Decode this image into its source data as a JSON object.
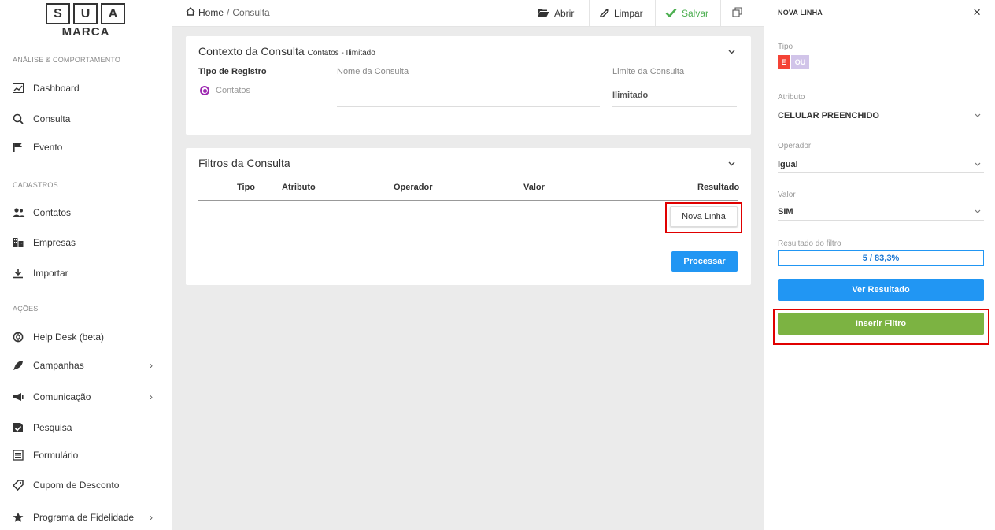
{
  "logo": {
    "letters": [
      "S",
      "U",
      "A"
    ],
    "text": "MARCA"
  },
  "sidebar": {
    "sections": [
      {
        "label": "ANÁLISE & COMPORTAMENTO"
      },
      {
        "label": "CADASTROS"
      },
      {
        "label": "AÇÕES"
      }
    ],
    "items": [
      {
        "label": "Dashboard",
        "icon": "chart-icon"
      },
      {
        "label": "Consulta",
        "icon": "search-icon"
      },
      {
        "label": "Evento",
        "icon": "flag-icon"
      },
      {
        "label": "Contatos",
        "icon": "contacts-icon"
      },
      {
        "label": "Empresas",
        "icon": "building-icon"
      },
      {
        "label": "Importar",
        "icon": "download-icon"
      },
      {
        "label": "Help Desk (beta)",
        "icon": "lifebuoy-icon"
      },
      {
        "label": "Campanhas",
        "icon": "rocket-icon",
        "chevron": "›"
      },
      {
        "label": "Comunicação",
        "icon": "megaphone-icon",
        "chevron": "›"
      },
      {
        "label": "Pesquisa",
        "icon": "survey-icon"
      },
      {
        "label": "Formulário",
        "icon": "form-icon"
      },
      {
        "label": "Cupom de Desconto",
        "icon": "tag-icon"
      },
      {
        "label": "Programa de Fidelidade",
        "icon": "star-icon",
        "chevron": "›"
      }
    ]
  },
  "topbar": {
    "breadcrumb": {
      "home": "Home",
      "separator": "/",
      "current": "Consulta"
    },
    "buttons": {
      "open": "Abrir",
      "clear": "Limpar",
      "save": "Salvar"
    }
  },
  "context_card": {
    "title": "Contexto da Consulta",
    "subtitle": "Contatos - Ilimitado",
    "record_type_label": "Tipo de Registro",
    "record_type_value": "Contatos",
    "name_label": "Nome da Consulta",
    "name_value": "",
    "limit_label": "Limite da Consulta",
    "limit_value": "Ilimitado"
  },
  "filters_card": {
    "title": "Filtros da Consulta",
    "columns": [
      "Tipo",
      "Atributo",
      "Operador",
      "Valor",
      "Resultado"
    ],
    "new_line_button": "Nova Linha",
    "process_button": "Processar"
  },
  "panel": {
    "title": "NOVA LINHA",
    "close": "×",
    "type_label": "Tipo",
    "type_options": [
      "E",
      "OU"
    ],
    "attribute_label": "Atributo",
    "attribute_value": "CELULAR PREENCHIDO",
    "operator_label": "Operador",
    "operator_value": "Igual",
    "value_label": "Valor",
    "value_value": "SIM",
    "result_label": "Resultado do filtro",
    "result_value": "5 / 83,3%",
    "view_result_button": "Ver Resultado",
    "insert_filter_button": "Inserir Filtro"
  },
  "colors": {
    "primary_blue": "#2196f3",
    "success_green": "#7cb342",
    "save_green": "#4caf50",
    "highlight_red": "#e00000",
    "radio_purple": "#9c27b0",
    "toggle_active": "#f44336",
    "toggle_inactive": "#d1c4e9"
  }
}
